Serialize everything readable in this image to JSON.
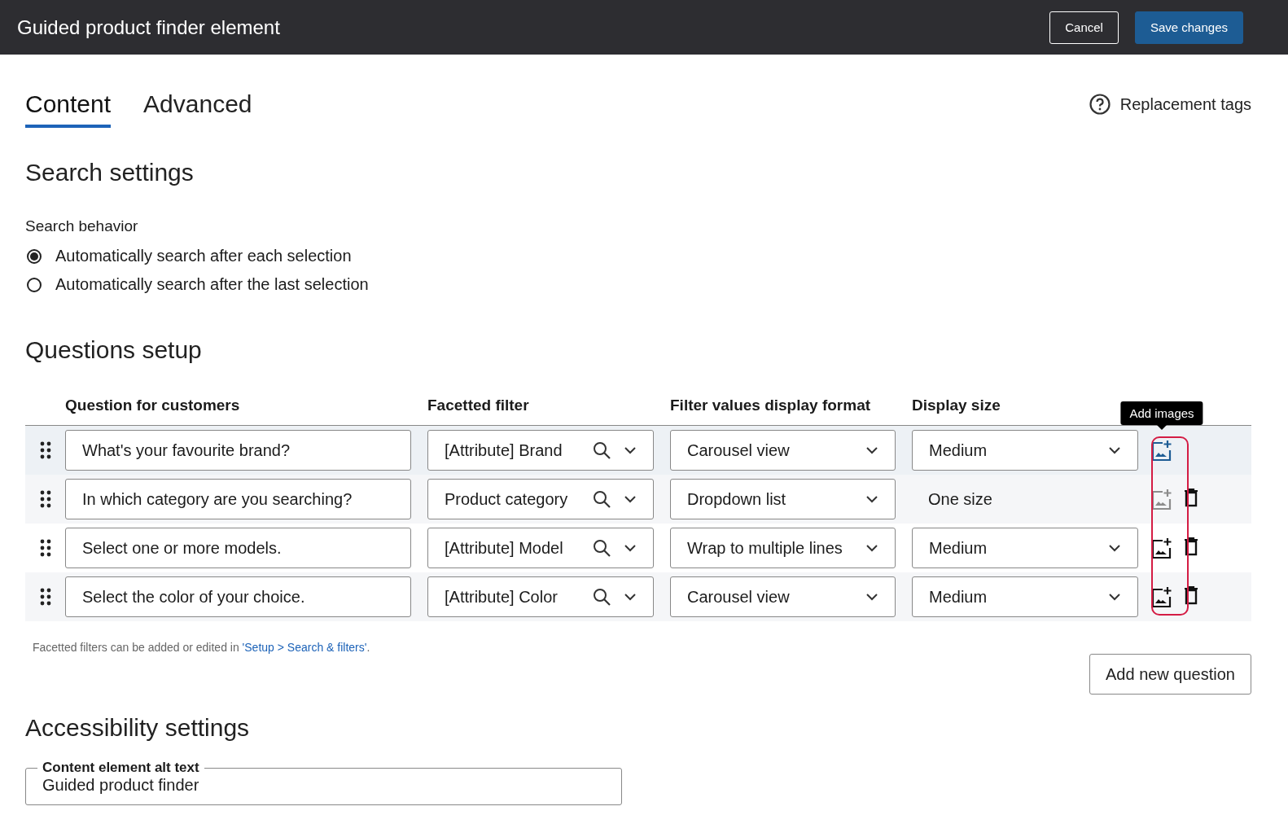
{
  "header": {
    "title": "Guided product finder element",
    "buttons": [
      {
        "label": "Cancel",
        "kind": "secondary"
      },
      {
        "label": "Save changes",
        "kind": "primary"
      }
    ]
  },
  "tabs": [
    {
      "label": "Content",
      "selected": true
    },
    {
      "label": "Advanced",
      "selected": false
    }
  ],
  "help_link": "Replacement tags",
  "search_settings": {
    "heading": "Search settings",
    "label": "Search behavior",
    "options": [
      {
        "label": "Automatically search after each selection",
        "selected": true
      },
      {
        "label": "Automatically search after the last selection",
        "selected": false
      }
    ]
  },
  "questions": {
    "heading": "Questions setup",
    "columns": [
      "Question for customers",
      "Facetted filter",
      "Filter values display format",
      "Display size"
    ],
    "tooltip": "Add images",
    "outline_images": true,
    "rows": [
      {
        "question": "What's your favourite brand?",
        "filter": "[Attribute] Brand",
        "format": "Carousel view",
        "size": {
          "kind": "select",
          "value": "Medium"
        },
        "highlighted": true,
        "image_disabled": false,
        "deletable": false
      },
      {
        "question": "In which category are you searching?",
        "filter": "Product category",
        "format": "Dropdown list",
        "size": {
          "kind": "text",
          "value": "One size"
        },
        "highlighted": false,
        "image_disabled": true,
        "deletable": true
      },
      {
        "question": "Select one or more models.",
        "filter": "[Attribute] Model",
        "format": "Wrap to multiple lines",
        "size": {
          "kind": "select",
          "value": "Medium"
        },
        "highlighted": false,
        "image_disabled": false,
        "deletable": true
      },
      {
        "question": "Select the color of your choice.",
        "filter": "[Attribute] Color",
        "format": "Carousel view",
        "size": {
          "kind": "select",
          "value": "Medium"
        },
        "highlighted": false,
        "image_disabled": false,
        "deletable": true
      }
    ],
    "note": "Facetted filters can be added or edited in ",
    "note_link": "'Setup > Search & filters'",
    "note_end": ".",
    "add_button": "Add new question"
  },
  "accessibility": {
    "heading": "Accessibility settings",
    "field_label": "Content element alt text",
    "field_value": "Guided product finder"
  }
}
